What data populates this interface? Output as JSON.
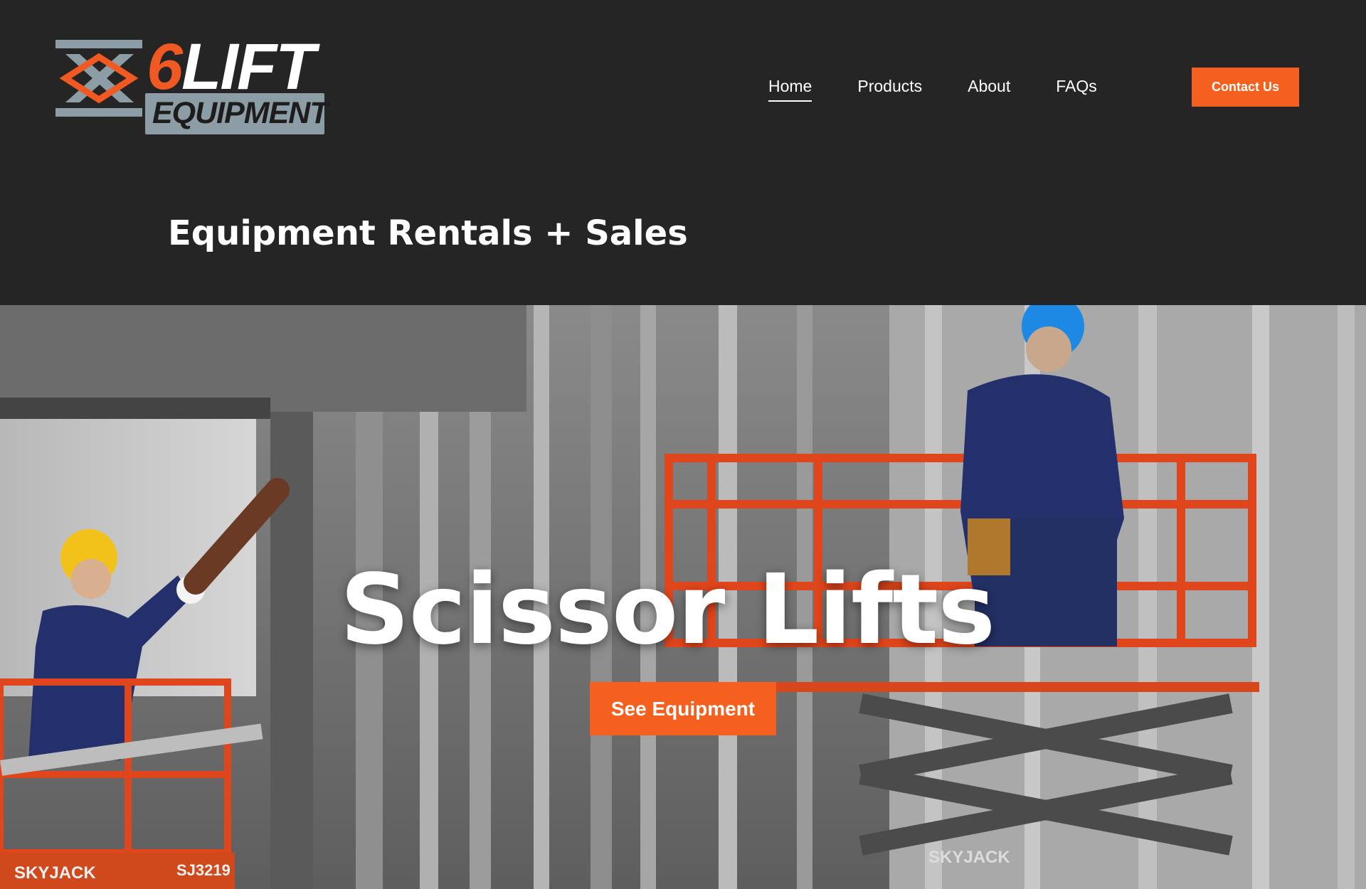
{
  "logo": {
    "six": "6",
    "lift": "LIFT",
    "equipment": "EQUIPMENT",
    "colors": {
      "orange": "#f05a22",
      "steel": "#8c9da5"
    }
  },
  "nav": {
    "items": [
      {
        "label": "Home",
        "active": true
      },
      {
        "label": "Products",
        "active": false
      },
      {
        "label": "About",
        "active": false
      },
      {
        "label": "FAQs",
        "active": false
      }
    ],
    "contact_label": "Contact Us"
  },
  "tagline": "Equipment Rentals + Sales",
  "hero": {
    "title": "Scissor Lifts",
    "cta_label": "See Equipment",
    "brand_marks": [
      "SKYJACK",
      "SJ3219"
    ]
  },
  "colors": {
    "accent": "#f5601f",
    "header_bg": "#252525"
  }
}
